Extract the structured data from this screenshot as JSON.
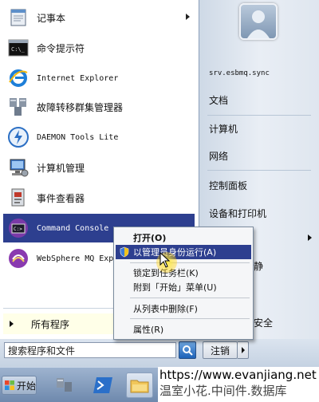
{
  "left_pane": {
    "programs": [
      {
        "label": "记事本",
        "icon": "notepad-icon",
        "has_submenu": true
      },
      {
        "label": "命令提示符",
        "icon": "cmd-icon"
      },
      {
        "label": "Internet Explorer",
        "icon": "ie-icon"
      },
      {
        "label": "故障转移群集管理器",
        "icon": "cluster-manager-icon"
      },
      {
        "label": "DAEMON Tools Lite",
        "icon": "daemon-tools-icon"
      },
      {
        "label": "计算机管理",
        "icon": "computer-management-icon"
      },
      {
        "label": "事件查看器",
        "icon": "event-viewer-icon"
      },
      {
        "label": "Command Console",
        "icon": "command-console-icon",
        "selected": true
      },
      {
        "label": "WebSphere MQ Exp",
        "icon": "websphere-mq-icon"
      }
    ],
    "all_programs_label": "所有程序"
  },
  "right_pane": {
    "items": [
      {
        "label": "srv.esbmq.sync"
      },
      {
        "label": "文档"
      },
      {
        "label": "计算机"
      },
      {
        "label": "网络"
      },
      {
        "label": "控制面板"
      },
      {
        "label": "设备和打印机"
      },
      {
        "label": "静"
      },
      {
        "label": "安全"
      }
    ]
  },
  "search": {
    "placeholder": "搜索程序和文件"
  },
  "logoff": {
    "label": "注销"
  },
  "context_menu": {
    "items": [
      {
        "label": "打开(O)"
      },
      {
        "label": "以管理员身份运行(A)"
      },
      {
        "label": "锁定到任务栏(K)"
      },
      {
        "label": "附到「开始」菜单(U)"
      },
      {
        "label": "从列表中删除(F)"
      },
      {
        "label": "属性(R)"
      }
    ]
  },
  "taskbar": {
    "start_label": "开始",
    "watermark_line1": "https://www.evanjiang.net",
    "watermark_line2": "温室小花.中间件.数据库"
  },
  "colors": {
    "selection": "#2d3f8f",
    "all_programs_bg": "#ffffe8",
    "taskbar": "#7f97b8"
  }
}
